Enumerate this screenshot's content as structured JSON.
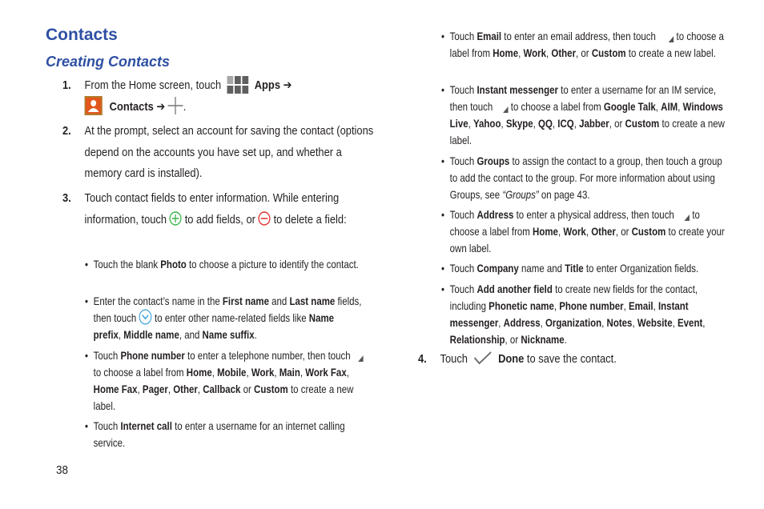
{
  "page": {
    "title": "Contacts",
    "subtitle": "Creating Contacts",
    "page_number": "38"
  },
  "colors": {
    "heading": "#2e4fa3",
    "text": "#231f20",
    "add_icon": "#3cb34a",
    "delete_icon": "#e0312f",
    "expand_icon": "#3aa0d8",
    "contacts_icon": "#e2561c"
  },
  "icons": {
    "apps": "apps-grid-icon",
    "contacts": "contacts-app-icon",
    "new": "plus-icon",
    "add": "add-circle-icon",
    "delete": "remove-circle-icon",
    "expand": "expand-chevron-icon",
    "label_menu": "corner-triangle-icon",
    "done": "checkmark-icon"
  },
  "steps": [
    {
      "num": "1.",
      "t1": "From the Home screen, touch",
      "apps": "Apps",
      "arrow": "➔",
      "contacts": "Contacts",
      "arrow2": "➔",
      "period": "."
    },
    {
      "num": "2.",
      "text": "At the prompt, select an account for saving the contact (options depend on the accounts you have set up, and whether a memory card is installed)."
    },
    {
      "num": "3.",
      "t1": "Touch contact fields to enter information. While entering information, touch",
      "t2": "to add fields, or",
      "t3": "to delete a field:"
    },
    {
      "num": "4.",
      "t1": "Touch",
      "done": "Done",
      "t2": "to save the contact."
    }
  ],
  "bullets": {
    "photo": {
      "a": "Touch the blank",
      "b": "Photo",
      "c": "to choose a picture to identify the contact."
    },
    "name": {
      "a": "Enter the contact’s name in the",
      "b": "First name",
      "c": "and",
      "d": "Last name",
      "e": "fields, then touch",
      "f": "to enter other name-related fields like",
      "g": "Name prefix",
      "h": ",",
      "i": "Middle name",
      "j": ", and",
      "k": "Name suffix",
      "l": "."
    },
    "phone": {
      "a": "Touch",
      "b": "Phone number",
      "c": "to enter a telephone number, then touch",
      "d": "to choose a label from",
      "labels": [
        "Home",
        "Mobile",
        "Work",
        "Main",
        "Work Fax",
        "Home Fax",
        "Pager",
        "Other",
        "Callback"
      ],
      "or": "or",
      "custom": "Custom",
      "end": "to create a new label."
    },
    "internet": {
      "a": "Touch",
      "b": "Internet call",
      "c": "to enter a username for an internet calling service."
    },
    "email": {
      "a": "Touch",
      "b": "Email",
      "c": "to enter an email address, then touch",
      "d": "to choose a label from",
      "labels": [
        "Home",
        "Work",
        "Other"
      ],
      "or": ", or",
      "custom": "Custom",
      "end": "to create a new label."
    },
    "im": {
      "a": "Touch",
      "b": "Instant messenger",
      "c": "to enter a username for an IM service, then touch",
      "d": "to choose a label from",
      "labels": [
        "Google Talk",
        "AIM",
        "Windows Live",
        "Yahoo",
        "Skype",
        "QQ",
        "ICQ",
        "Jabber"
      ],
      "or": ", or",
      "custom": "Custom",
      "end": "to create a new label."
    },
    "groups": {
      "a": "Touch",
      "b": "Groups",
      "c": "to assign the contact to a group, then touch a group to add the contact to the group. For more information about using Groups, see",
      "link": "“Groups”",
      "d": "on page 43."
    },
    "address": {
      "a": "Touch",
      "b": "Address",
      "c": "to enter a physical address, then touch",
      "d": "to choose a label from",
      "labels": [
        "Home",
        "Work",
        "Other"
      ],
      "or": ", or",
      "custom": "Custom",
      "end": "to create your own label."
    },
    "company": {
      "a": "Touch",
      "b": "Company",
      "c": "name and",
      "d": "Title",
      "e": "to enter Organization fields."
    },
    "another": {
      "a": "Touch",
      "b": "Add another field",
      "c": "to create new fields for the contact, including",
      "fields": [
        "Phonetic name",
        "Phone number",
        "Email",
        "Instant messenger",
        "Address",
        "Organization",
        "Notes",
        "Website",
        "Event",
        "Relationship"
      ],
      "or": ", or",
      "last": "Nickname",
      "end": "."
    }
  },
  "bullet_char": "•"
}
